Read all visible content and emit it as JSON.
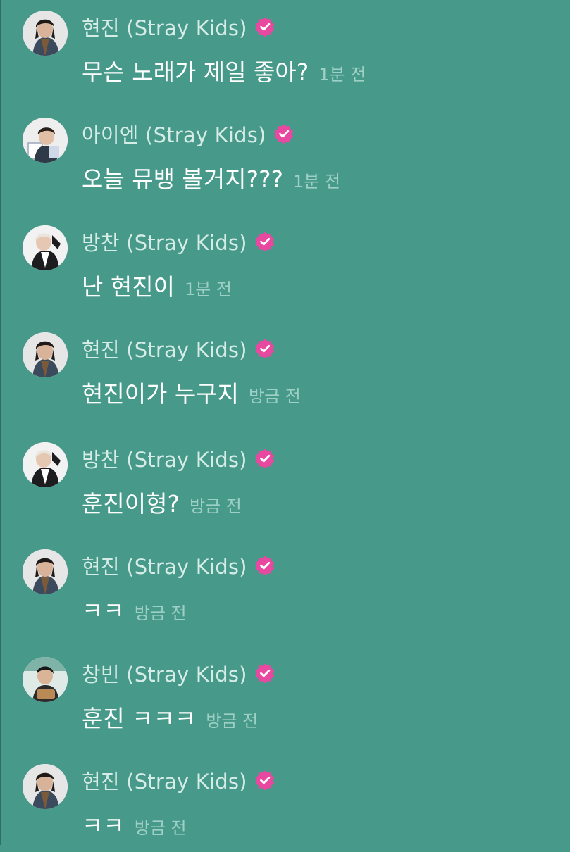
{
  "colors": {
    "background": "#47998A",
    "username": "#d6ece7",
    "message": "#ffffff",
    "timestamp": "#9fd0c6",
    "verified_badge": "#e8489f"
  },
  "icons": {
    "verified": "verified-badge-icon"
  },
  "messages": [
    {
      "avatar": "hyunjin",
      "username": "현진 (Stray Kids)",
      "verified": true,
      "text": "무슨 노래가 제일 좋아?",
      "time": "1분 전"
    },
    {
      "avatar": "in",
      "username": "아이엔 (Stray Kids)",
      "verified": true,
      "text": "오늘 뮤뱅 볼거지???",
      "time": "1분 전"
    },
    {
      "avatar": "bangchan",
      "username": "방찬 (Stray Kids)",
      "verified": true,
      "text": "난 현진이",
      "time": "1분 전"
    },
    {
      "avatar": "hyunjin",
      "username": "현진 (Stray Kids)",
      "verified": true,
      "text": "현진이가 누구지",
      "time": "방금 전"
    },
    {
      "avatar": "bangchan",
      "username": "방찬 (Stray Kids)",
      "verified": true,
      "text": "훈진이형?",
      "time": "방금 전"
    },
    {
      "avatar": "hyunjin",
      "username": "현진 (Stray Kids)",
      "verified": true,
      "text": "ㅋㅋ",
      "time": "방금 전"
    },
    {
      "avatar": "changbin",
      "username": "창빈 (Stray Kids)",
      "verified": true,
      "text": "훈진 ㅋㅋㅋ",
      "time": "방금 전"
    },
    {
      "avatar": "hyunjin",
      "username": "현진 (Stray Kids)",
      "verified": true,
      "text": "ㅋㅋ",
      "time": "방금 전"
    }
  ]
}
